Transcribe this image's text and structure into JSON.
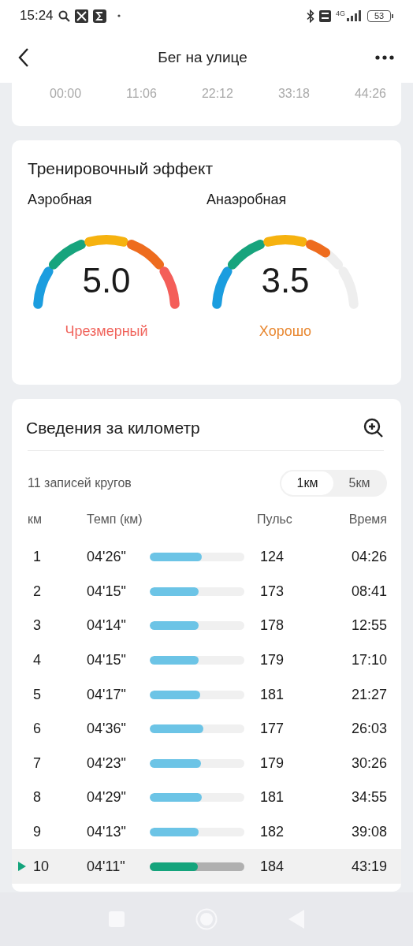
{
  "status_bar": {
    "time": "15:24",
    "network": "4G",
    "battery": "53"
  },
  "header": {
    "title": "Бег на улице"
  },
  "timeline": {
    "ticks": [
      "00:00",
      "11:06",
      "22:12",
      "33:18",
      "44:26"
    ]
  },
  "training_effect": {
    "title": "Тренировочный эффект",
    "gauges": [
      {
        "label": "Аэробная",
        "value": "5.0",
        "status": "Чрезмерный",
        "color": "#f0645c"
      },
      {
        "label": "Анаэробная",
        "value": "3.5",
        "status": "Хорошо",
        "color": "#e8862e"
      }
    ]
  },
  "laps": {
    "title": "Сведения за километр",
    "count": "11 записей кругов",
    "units": [
      {
        "label": "1км",
        "selected": true
      },
      {
        "label": "5км",
        "selected": false
      }
    ],
    "columns": [
      "км",
      "Темп (км)",
      "Пульс",
      "Время"
    ],
    "rows": [
      {
        "km": "1",
        "pace": "04'26\"",
        "level": 0.55,
        "pulse": "124",
        "time": "04:26",
        "selected": false
      },
      {
        "km": "2",
        "pace": "04'15\"",
        "level": 0.52,
        "pulse": "173",
        "time": "08:41",
        "selected": false
      },
      {
        "km": "3",
        "pace": "04'14\"",
        "level": 0.52,
        "pulse": "178",
        "time": "12:55",
        "selected": false
      },
      {
        "km": "4",
        "pace": "04'15\"",
        "level": 0.52,
        "pulse": "179",
        "time": "17:10",
        "selected": false
      },
      {
        "km": "5",
        "pace": "04'17\"",
        "level": 0.53,
        "pulse": "181",
        "time": "21:27",
        "selected": false
      },
      {
        "km": "6",
        "pace": "04'36\"",
        "level": 0.57,
        "pulse": "177",
        "time": "26:03",
        "selected": false
      },
      {
        "km": "7",
        "pace": "04'23\"",
        "level": 0.54,
        "pulse": "179",
        "time": "30:26",
        "selected": false
      },
      {
        "km": "8",
        "pace": "04'29\"",
        "level": 0.55,
        "pulse": "181",
        "time": "34:55",
        "selected": false
      },
      {
        "km": "9",
        "pace": "04'13\"",
        "level": 0.52,
        "pulse": "182",
        "time": "39:08",
        "selected": false
      },
      {
        "km": "10",
        "pace": "04'11\"",
        "level": 0.51,
        "pulse": "184",
        "time": "43:19",
        "selected": true
      }
    ]
  }
}
